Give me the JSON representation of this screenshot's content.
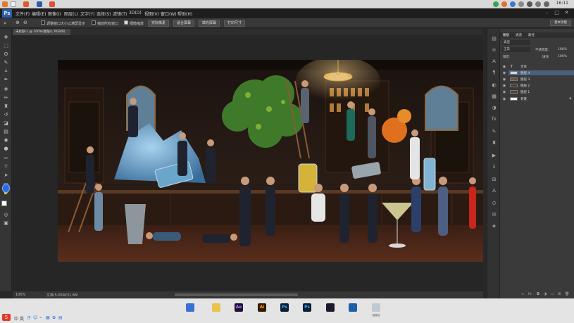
{
  "menubar": {
    "logo": "Ps",
    "items": [
      "文件(F)",
      "编辑(E)",
      "图像(I)",
      "图层(L)",
      "文字(Y)",
      "选择(S)",
      "滤镜(T)",
      "3D(D)",
      "视图(V)",
      "窗口(W)",
      "帮助(H)"
    ]
  },
  "options_bar": {
    "checkbox_resize_windows": "调整窗口大小以满屏显示",
    "checkbox_zoom_all": "缩放所有窗口",
    "checkbox_scrubby": "细微缩放",
    "btn_actual_pixels": "实际像素",
    "btn_fit_screen": "适合屏幕",
    "btn_fill_screen": "填充屏幕",
    "btn_print_size": "打印尺寸",
    "workspace": "基本功能"
  },
  "document": {
    "tab_title": "未标题-1 @ 100%(图层4, RGB/8)",
    "zoom": "100%",
    "doc_info": "文档:5.65M/31.8M"
  },
  "layers_panel": {
    "tabs": [
      "图层",
      "通道",
      "路径"
    ],
    "kind_label": "类型",
    "blend_mode": "正常",
    "opacity_label": "不透明度:",
    "opacity_value": "100%",
    "lock_label": "锁定:",
    "fill_label": "填充:",
    "fill_value": "100%",
    "layers": [
      {
        "name": "文本",
        "type": "text",
        "selected": false
      },
      {
        "name": "图层 4",
        "type": "pixel",
        "selected": true
      },
      {
        "name": "图层 3",
        "type": "pixel",
        "selected": false
      },
      {
        "name": "图层 2",
        "type": "pixel",
        "selected": false
      },
      {
        "name": "图层 1",
        "type": "pixel",
        "selected": false
      },
      {
        "name": "背景",
        "type": "background",
        "selected": false
      }
    ]
  },
  "taskbar": {
    "ime_items": [
      "中",
      "英"
    ],
    "dock": [
      {
        "abbr": "",
        "label": "",
        "color": "#3b6fd6"
      },
      {
        "abbr": "",
        "label": "",
        "color": "#e8c44a"
      },
      {
        "abbr": "Ae",
        "label": "",
        "color": "#1f1036"
      },
      {
        "abbr": "Ai",
        "label": "",
        "color": "#2e1a05"
      },
      {
        "abbr": "Ps",
        "label": "",
        "color": "#0b1e33"
      },
      {
        "abbr": "Ps",
        "label": "",
        "color": "#0b1e33"
      },
      {
        "abbr": "",
        "label": "",
        "color": "#1a1a2a"
      },
      {
        "abbr": "",
        "label": "",
        "color": "#1b5fa8"
      },
      {
        "abbr": "",
        "label": "回收站",
        "color": "#c0c8d0"
      }
    ]
  },
  "os_topbar": {
    "clock": "16:11"
  },
  "colors": {
    "ps_blue": "#2b5da8",
    "panel_bg": "#3a3a3a",
    "selected_layer": "#4b5e7e"
  }
}
